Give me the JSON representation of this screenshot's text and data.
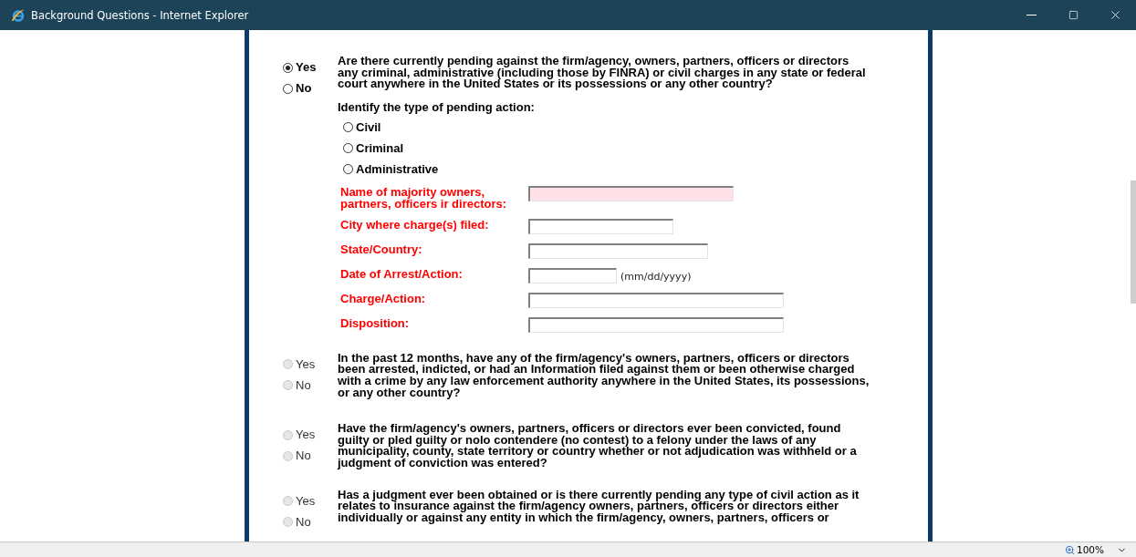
{
  "window": {
    "title": "Background Questions - Internet Explorer"
  },
  "questions": [
    {
      "text": "Are there currently pending against the firm/agency, owners, partners, officers or directors any criminal, administrative (including those by FINRA) or civil charges in any state or federal court anywhere in the United States or its possessions or any other country?",
      "disabled": false,
      "options": [
        {
          "label": "Yes",
          "selected": true
        },
        {
          "label": "No",
          "selected": false
        }
      ],
      "details": {
        "prompt": "Identify the type of pending action:",
        "action_types": [
          {
            "label": "Civil",
            "selected": false
          },
          {
            "label": "Criminal",
            "selected": false
          },
          {
            "label": "Administrative",
            "selected": false
          }
        ],
        "fields": [
          {
            "label": "Name of majority owners, partners, officers ir directors:",
            "highlighted": true
          },
          {
            "label": "City where charge(s) filed:",
            "highlighted": false
          },
          {
            "label": "State/Country:",
            "highlighted": false
          },
          {
            "label": "Date of Arrest/Action:",
            "highlighted": false,
            "hint": "(mm/dd/yyyy)"
          },
          {
            "label": "Charge/Action:",
            "highlighted": false
          },
          {
            "label": "Disposition:",
            "highlighted": false
          }
        ]
      }
    },
    {
      "text": "In the past 12 months, have any of the firm/agency's owners, partners, officers or directors been arrested, indicted, or had an Information filed against them or been otherwise charged with a crime by any law enforcement authority anywhere in the United States, its possessions, or any other country?",
      "disabled": true,
      "options": [
        {
          "label": "Yes",
          "selected": false
        },
        {
          "label": "No",
          "selected": false
        }
      ]
    },
    {
      "text": "Have the firm/agency's owners, partners, officers or directors ever been convicted, found guilty or pled guilty or nolo contendere (no contest) to a felony under the laws of any municipality, county, state territory or country whether or not adjudication was withheld or a judgment of conviction was entered?",
      "disabled": true,
      "options": [
        {
          "label": "Yes",
          "selected": false
        },
        {
          "label": "No",
          "selected": false
        }
      ]
    },
    {
      "text": "Has a judgment ever been obtained or is there currently pending any type of civil action as it relates to insurance against the firm/agency owners, partners, officers or directors either individually or against any entity in which the firm/agency, owners, partners, officers or",
      "disabled": true,
      "options": [
        {
          "label": "Yes",
          "selected": false
        },
        {
          "label": "No",
          "selected": false
        }
      ]
    }
  ],
  "status_bar": {
    "zoom": "100%"
  }
}
